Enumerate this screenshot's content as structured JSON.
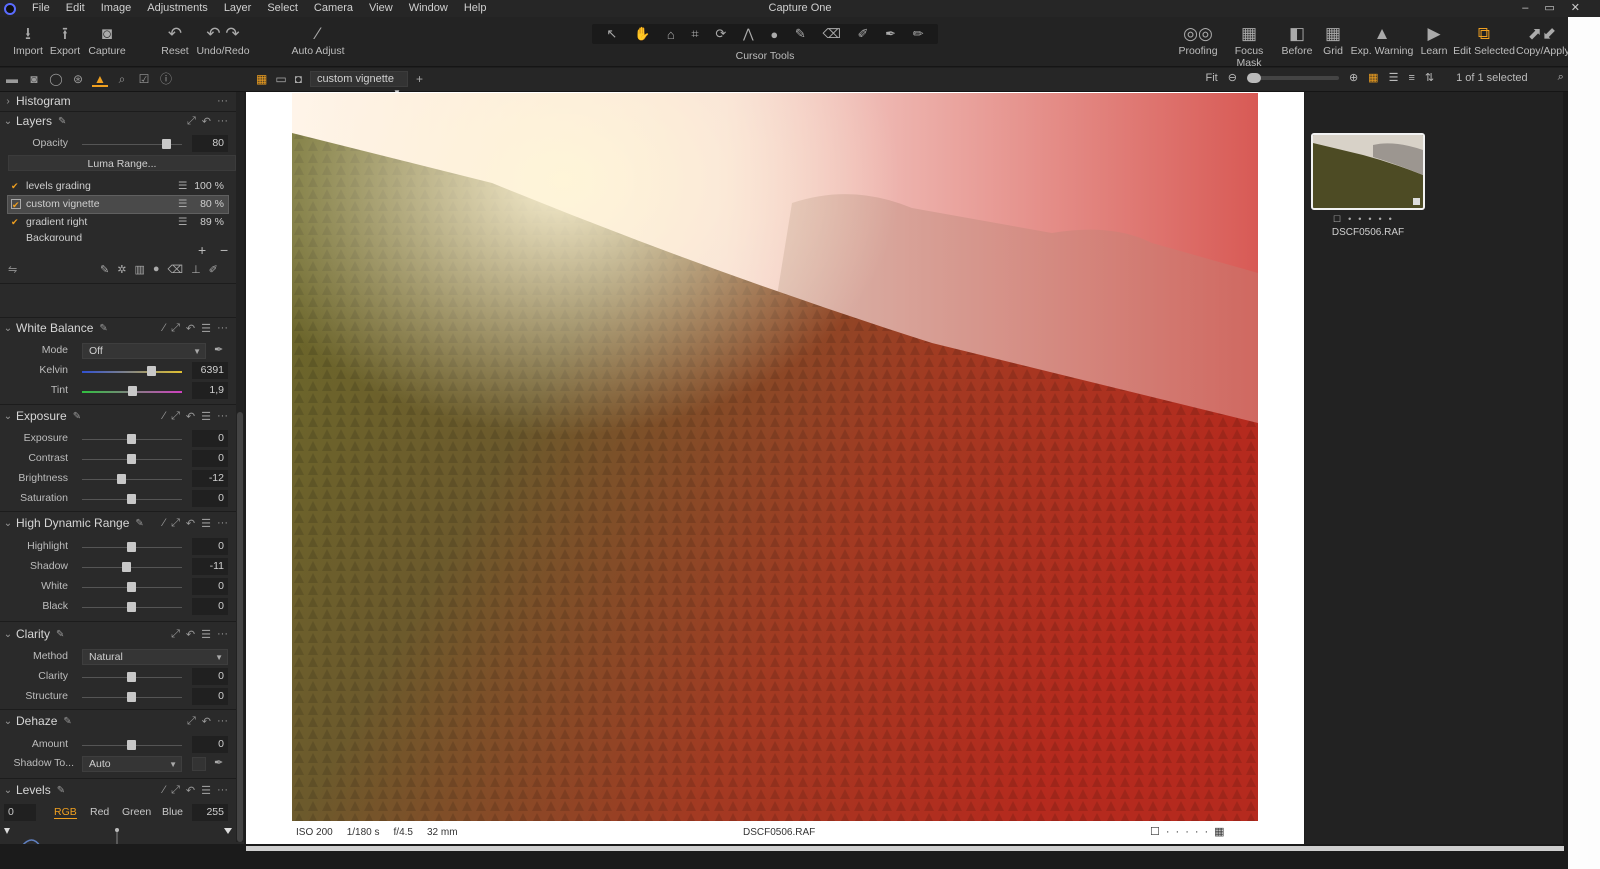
{
  "menubar": {
    "items": [
      "File",
      "Edit",
      "Image",
      "Adjustments",
      "Layer",
      "Select",
      "Camera",
      "View",
      "Window",
      "Help"
    ],
    "title": "Capture One",
    "controls": [
      "–",
      "▭",
      "✕"
    ]
  },
  "toolbar": {
    "left_buttons": [
      "Import",
      "Export",
      "Capture",
      "Reset",
      "Undo/Redo",
      "Auto Adjust"
    ],
    "cursor_tools_label": "Cursor Tools",
    "right_buttons": [
      "Proofing",
      "Focus Mask",
      "Before",
      "Grid",
      "Exp. Warning",
      "Learn",
      "Edit Selected",
      "Copy/Apply"
    ],
    "accent": "#f0a020"
  },
  "subbar": {
    "variant_name": "custom vignette",
    "zoom": "Fit",
    "selection_count": "1 of 1 selected"
  },
  "histogram": {
    "title": "Histogram"
  },
  "layers": {
    "title": "Layers",
    "opacity_label": "Opacity",
    "opacity_value": "80",
    "luma_range_label": "Luma Range...",
    "items": [
      {
        "name": "levels grading",
        "percent": "100 %"
      },
      {
        "name": "custom vignette",
        "percent": "80 %"
      },
      {
        "name": "gradient right",
        "percent": "89 %"
      },
      {
        "name": "Background",
        "percent": ""
      }
    ]
  },
  "white_balance": {
    "title": "White Balance",
    "mode_label": "Mode",
    "mode_value": "Off",
    "kelvin_label": "Kelvin",
    "kelvin_value": "6391",
    "tint_label": "Tint",
    "tint_value": "1,9"
  },
  "exposure": {
    "title": "Exposure",
    "rows": [
      {
        "label": "Exposure",
        "value": "0"
      },
      {
        "label": "Contrast",
        "value": "0"
      },
      {
        "label": "Brightness",
        "value": "-12"
      },
      {
        "label": "Saturation",
        "value": "0"
      }
    ]
  },
  "hdr": {
    "title": "High Dynamic Range",
    "rows": [
      {
        "label": "Highlight",
        "value": "0"
      },
      {
        "label": "Shadow",
        "value": "-11"
      },
      {
        "label": "White",
        "value": "0"
      },
      {
        "label": "Black",
        "value": "0"
      }
    ]
  },
  "clarity": {
    "title": "Clarity",
    "method_label": "Method",
    "method_value": "Natural",
    "rows": [
      {
        "label": "Clarity",
        "value": "0"
      },
      {
        "label": "Structure",
        "value": "0"
      }
    ]
  },
  "dehaze": {
    "title": "Dehaze",
    "amount_label": "Amount",
    "amount_value": "0",
    "shadow_tone_label": "Shadow To...",
    "shadow_tone_value": "Auto"
  },
  "levels": {
    "title": "Levels",
    "low_value": "0",
    "channels": [
      "RGB",
      "Red",
      "Green",
      "Blue"
    ],
    "high_value": "255"
  },
  "viewer": {
    "iso": "ISO 200",
    "shutter": "1/180 s",
    "aperture": "f/4.5",
    "focal": "32 mm",
    "filename": "DSCF0506.RAF"
  },
  "browser": {
    "thumb_name": "DSCF0506.RAF"
  }
}
